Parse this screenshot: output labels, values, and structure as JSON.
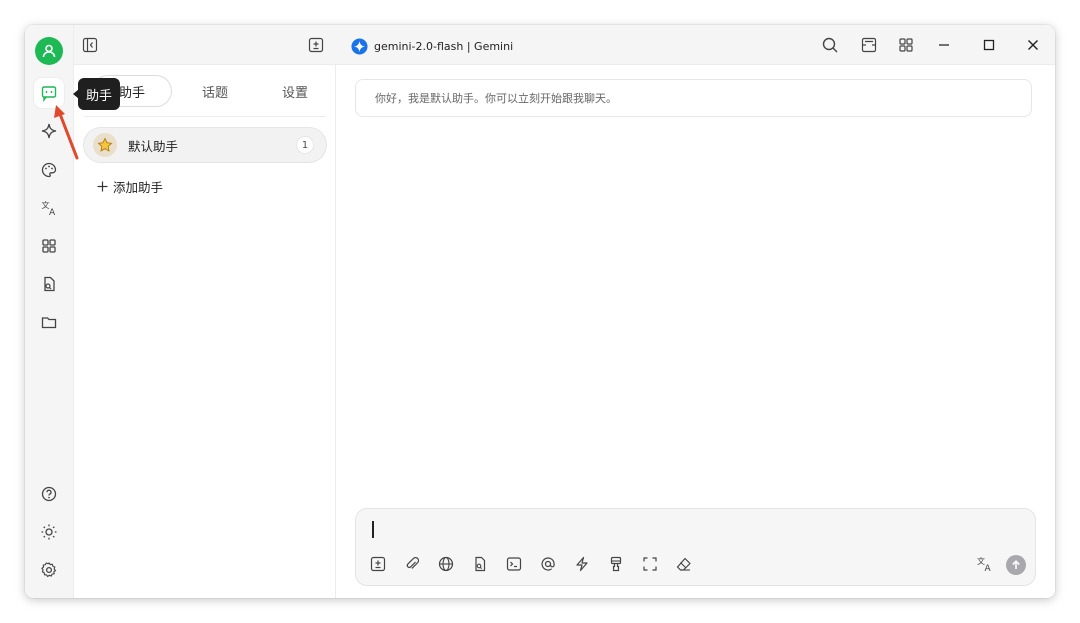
{
  "titlebar": {
    "model_title": "gemini-2.0-flash | Gemini"
  },
  "rail": {
    "items": [
      {
        "name": "assistant",
        "icon": "chat-icon",
        "active": true
      },
      {
        "name": "agents",
        "icon": "sparkle-icon"
      },
      {
        "name": "paint",
        "icon": "palette-icon"
      },
      {
        "name": "translate",
        "icon": "translate-icon"
      },
      {
        "name": "apps",
        "icon": "grid-icon"
      },
      {
        "name": "files",
        "icon": "document-icon"
      },
      {
        "name": "folder",
        "icon": "folder-icon"
      }
    ],
    "bottom": [
      {
        "name": "help",
        "icon": "help-icon"
      },
      {
        "name": "theme",
        "icon": "sun-icon"
      },
      {
        "name": "settings",
        "icon": "gear-icon"
      }
    ]
  },
  "tooltip": {
    "text": "助手"
  },
  "panel": {
    "tabs": [
      {
        "label": "助手",
        "active": true
      },
      {
        "label": "话题"
      },
      {
        "label": "设置"
      }
    ],
    "assistants": [
      {
        "name": "默认助手",
        "count": "1",
        "icon": "star-icon"
      }
    ],
    "add_label": "添加助手"
  },
  "main": {
    "greeting": "你好，我是默认助手。你可以立刻开始跟我聊天。"
  },
  "input": {
    "value": "",
    "toolbar_icons": [
      "new-topic-icon",
      "attachment-icon",
      "globe-icon",
      "document-icon",
      "terminal-icon",
      "mention-icon",
      "lightning-icon",
      "brush-icon",
      "expand-icon",
      "eraser-icon",
      "translate-icon",
      "send-icon"
    ]
  },
  "colors": {
    "accent_green": "#1db954",
    "model_blue": "#1a73e8",
    "annotation_red": "#e04a2a"
  }
}
